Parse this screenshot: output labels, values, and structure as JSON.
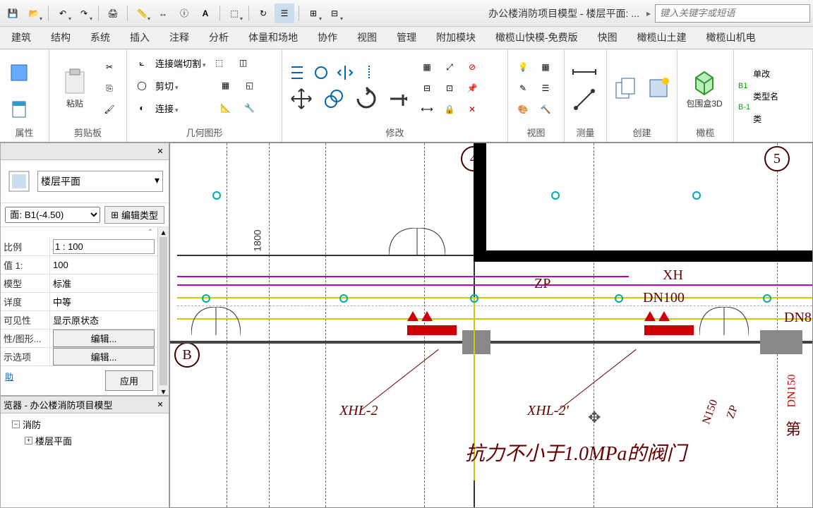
{
  "qat": {
    "title": "办公楼消防项目模型 - 楼层平面: ...",
    "search_placeholder": "键入关键字或短语"
  },
  "tabs": [
    "建筑",
    "结构",
    "系统",
    "插入",
    "注释",
    "分析",
    "体量和场地",
    "协作",
    "视图",
    "管理",
    "附加模块",
    "橄榄山快模-免费版",
    "快图",
    "橄榄山土建",
    "橄榄山机电"
  ],
  "ribbon": {
    "g_props": "属性",
    "g_clip": "剪贴板",
    "paste": "粘贴",
    "g_geom": "几何图形",
    "cut_end": "连接端切割",
    "cut": "剪切",
    "join": "连接",
    "g_modify": "修改",
    "g_view": "视图",
    "g_measure": "测量",
    "g_create": "创建",
    "g_olive": "橄榄",
    "box3d": "包围盒3D",
    "single": "单改",
    "typename": "类型名",
    "cat": "类",
    "level1": "B1",
    "level2": "B-1"
  },
  "properties": {
    "panel_title": "",
    "type_label": "楼层平面",
    "instance_label": "面: B1(-4.50)",
    "edit_type": "编辑类型",
    "rows": {
      "scale": {
        "k": "比例",
        "v": "1 : 100"
      },
      "value1": {
        "k": "值 1:",
        "v": "100"
      },
      "model": {
        "k": "模型",
        "v": "标准"
      },
      "detail": {
        "k": "详度",
        "v": "中等"
      },
      "visibility": {
        "k": "可见性",
        "v": "显示原状态"
      },
      "graphics": {
        "k": "性/图形...",
        "btn": "编辑..."
      },
      "display": {
        "k": "示选项",
        "btn": "编辑..."
      }
    },
    "help": "助",
    "apply": "应用"
  },
  "browser": {
    "title": "览器 - 办公楼消防项目模型",
    "items": [
      "消防",
      "楼层平面"
    ]
  },
  "canvas": {
    "grid4": "4",
    "grid5": "5",
    "gridB": "B",
    "dim1800": "1800",
    "zp": "ZP",
    "xh": "XH",
    "dn100": "DN100",
    "dn8": "DN8",
    "xhl2": "XHL-2",
    "xhl2p": "XHL-2'",
    "note": "抗力不小于1.0MPa的阀门",
    "n150": "N150",
    "zp2": "ZP",
    "dn150": "DN150",
    "partial": "第"
  }
}
